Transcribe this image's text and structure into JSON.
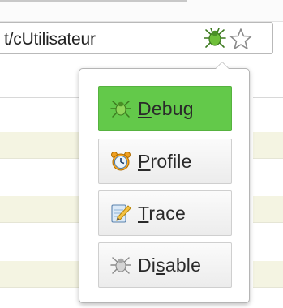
{
  "address_bar": {
    "url_text": "t/cUtilisateur",
    "bug_icon": "firebug-bug-icon",
    "star_icon": "bookmark-star-icon"
  },
  "popup_menu": {
    "items": [
      {
        "label": "Debug",
        "mnemonic_index": 0,
        "icon": "bug-icon",
        "state": "active",
        "color": "#63c94a"
      },
      {
        "label": "Profile",
        "mnemonic_index": 0,
        "icon": "alarm-clock-icon",
        "state": "normal"
      },
      {
        "label": "Trace",
        "mnemonic_index": 0,
        "icon": "notepad-pencil-icon",
        "state": "normal"
      },
      {
        "label": "Disable",
        "mnemonic_index": 2,
        "icon": "gray-bug-icon",
        "state": "normal"
      }
    ]
  },
  "colors": {
    "active_item": "#63c94a",
    "row_stripe": "#f4f4e2"
  }
}
